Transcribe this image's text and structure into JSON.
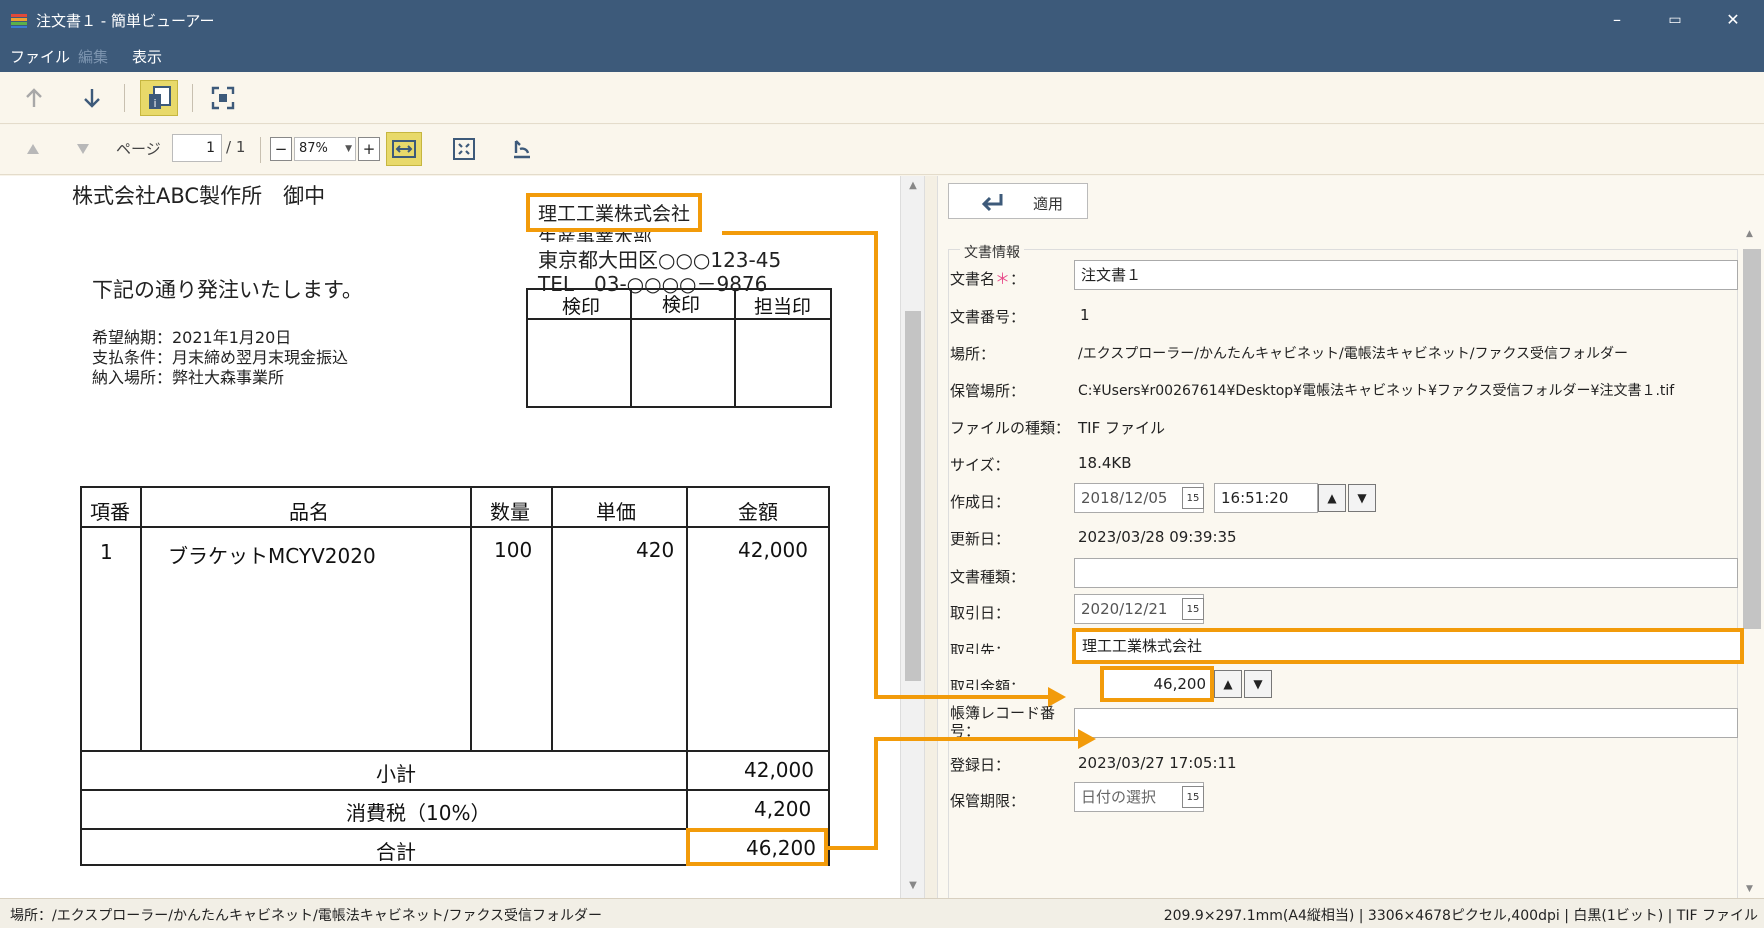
{
  "window": {
    "title": "注文書１ - 簡単ビューアー",
    "minimize": "–",
    "maximize": "▭",
    "close": "✕"
  },
  "menu": [
    "ファイル",
    "編集",
    "表示"
  ],
  "toolbar2": {
    "page_label": "ページ",
    "page_value": "1",
    "page_total": "/ 1",
    "zoom_minus": "−",
    "zoom_value": "87%",
    "zoom_plus": "+"
  },
  "document": {
    "addressee": "株式会社ABC製作所　御中",
    "sender_name": "理工工業株式会社",
    "sender_dept": "生産事業本部",
    "sender_address": "東京都大田区○○○123-45",
    "sender_tel": "TEL　03-○○○○－9876",
    "intro": "下記の通り発注いたします。",
    "terms": [
      "希望納期：2021年1月20日",
      "支払条件：月末締め翌月末現金振込",
      "納入場所：弊社大森事業所"
    ],
    "stamps": [
      "検印",
      "検印",
      "担当印"
    ],
    "table": {
      "headers": [
        "項番",
        "品名",
        "数量",
        "単価",
        "金額"
      ],
      "row": [
        "1",
        "ブラケットMCYV2020",
        "100",
        "420",
        "42,000"
      ],
      "subtotal_label": "小計",
      "subtotal": "42,000",
      "tax_label": "消費税（10%）",
      "tax": "4,200",
      "total_label": "合計",
      "total": "46,200"
    }
  },
  "panel": {
    "apply": "適用",
    "section_title": "文書情報",
    "fields": {
      "doc_name_label": "文書名",
      "required_mark": "＊",
      "colon": "：",
      "doc_name": "注文書１",
      "doc_number_label": "文書番号：",
      "doc_number": "1",
      "location_label": "場所：",
      "location": "/エクスプローラー/かんたんキャビネット/電帳法キャビネット/ファクス受信フォルダー",
      "storage_label": "保管場所：",
      "storage": "C:¥Users¥r00267614¥Desktop¥電帳法キャビネット¥ファクス受信フォルダー¥注文書１.tif",
      "file_type_label": "ファイルの種類：",
      "file_type": "TIF ファイル",
      "size_label": "サイズ：",
      "size": "18.4KB",
      "created_label": "作成日：",
      "created_date": "2018/12/05",
      "created_time": "16:51:20",
      "updated_label": "更新日：",
      "updated": "2023/03/28 09:39:35",
      "doc_type_label": "文書種類：",
      "doc_type": "",
      "trade_date_label": "取引日：",
      "trade_date": "2020/12/21",
      "partner_label": "取引先：",
      "partner": "理工工業株式会社",
      "amount_label": "取引金額：",
      "amount": "46,200",
      "ledger_label": "帳簿レコード番号",
      "ledger": "",
      "registered_label": "登録日：",
      "registered": "2023/03/27 17:05:11",
      "retention_label": "保管期限：",
      "retention_placeholder": "日付の選択",
      "calendar_day": "15"
    }
  },
  "status": {
    "location": "場所：/エクスプローラー/かんたんキャビネット/電帳法キャビネット/ファクス受信フォルダー",
    "info": "209.9×297.1mm(A4縦相当) | 3306×4678ピクセル,400dpi | 白黒(1ビット) | TIF ファイル"
  },
  "colors": {
    "titlebar": "#3d5a7a",
    "highlight": "#f29b0a",
    "active_tool": "#e8d96a"
  }
}
